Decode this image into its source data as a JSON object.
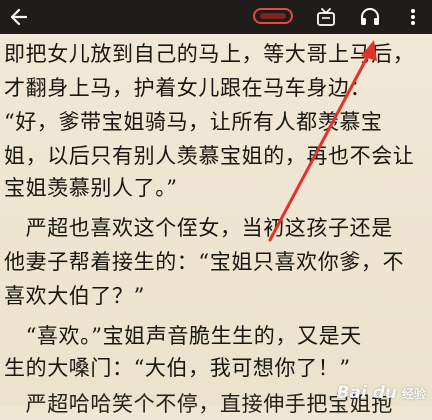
{
  "toolbar": {
    "back_icon": "back-arrow-icon",
    "tv_icon": "tv-icon",
    "listen_icon": "headphones-icon",
    "more_icon": "more-vertical-icon",
    "pill_color": "#e24b3d"
  },
  "content": {
    "lines": [
      "即把女儿放到自己的马上，等大哥上马后，",
      "才翻身上马，护着女儿跟在马车身边：",
      "“好，爹带宝姐骑马，让所有人都羡慕宝",
      "姐，以后只有别人羡慕宝姐的，再也不会让",
      "宝姐羡慕别人了。”",
      "",
      "　严超也喜欢这个侄女，当初这孩子还是",
      "他妻子帮着接生的：“宝姐只喜欢你爹，不",
      "喜欢大伯了？”",
      "",
      "　“喜欢。”宝姐声音脆生生的，又是天",
      "生的大嗓门：“大伯，我可想你了！”",
      "　严超哈哈笑个不停，直接伸手把宝姐抱"
    ]
  },
  "annotation": {
    "arrow_color": "#e2332a"
  },
  "watermark": {
    "logo": "Bai du",
    "sub": "经验"
  }
}
